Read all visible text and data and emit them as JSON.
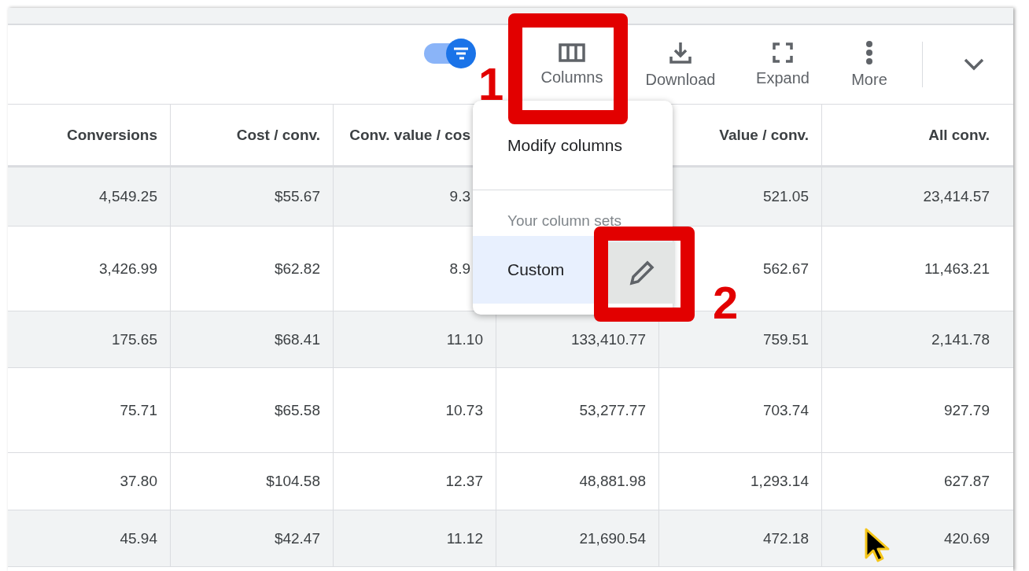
{
  "toolbar": {
    "toggle": {
      "on": true
    },
    "actions": [
      {
        "kind": "columns",
        "label": "Columns"
      },
      {
        "kind": "download",
        "label": "Download"
      },
      {
        "kind": "expand",
        "label": "Expand"
      },
      {
        "kind": "more",
        "label": "More"
      }
    ]
  },
  "table": {
    "columns": [
      "Conversions",
      "Cost / conv.",
      "Conv. value / cos",
      null,
      "Value / conv.",
      "All conv."
    ],
    "rows": [
      {
        "shaded": true,
        "cells": [
          "4,549.25",
          "$55.67",
          "9.3",
          null,
          "521.05",
          "23,414.57"
        ]
      },
      {
        "shaded": false,
        "cells": [
          "3,426.99",
          "$62.82",
          "8.9",
          null,
          "562.67",
          "11,463.21"
        ]
      },
      {
        "shaded": true,
        "cells": [
          "175.65",
          "$68.41",
          "11.10",
          "133,410.77",
          "759.51",
          "2,141.78"
        ]
      },
      {
        "shaded": false,
        "cells": [
          "75.71",
          "$65.58",
          "10.73",
          "53,277.77",
          "703.74",
          "927.79"
        ]
      },
      {
        "shaded": false,
        "cells": [
          "37.80",
          "$104.58",
          "12.37",
          "48,881.98",
          "1,293.14",
          "627.87"
        ]
      },
      {
        "shaded": true,
        "cells": [
          "45.94",
          "$42.47",
          "11.12",
          "21,690.54",
          "472.18",
          "420.69"
        ]
      }
    ]
  },
  "menu": {
    "items": [
      {
        "kind": "action",
        "label": "Modify columns"
      },
      {
        "kind": "section",
        "label": "Your column sets"
      },
      {
        "kind": "set",
        "label": "Custom",
        "selected": true
      }
    ]
  },
  "annotations": [
    {
      "label": "1"
    },
    {
      "label": "2"
    }
  ]
}
